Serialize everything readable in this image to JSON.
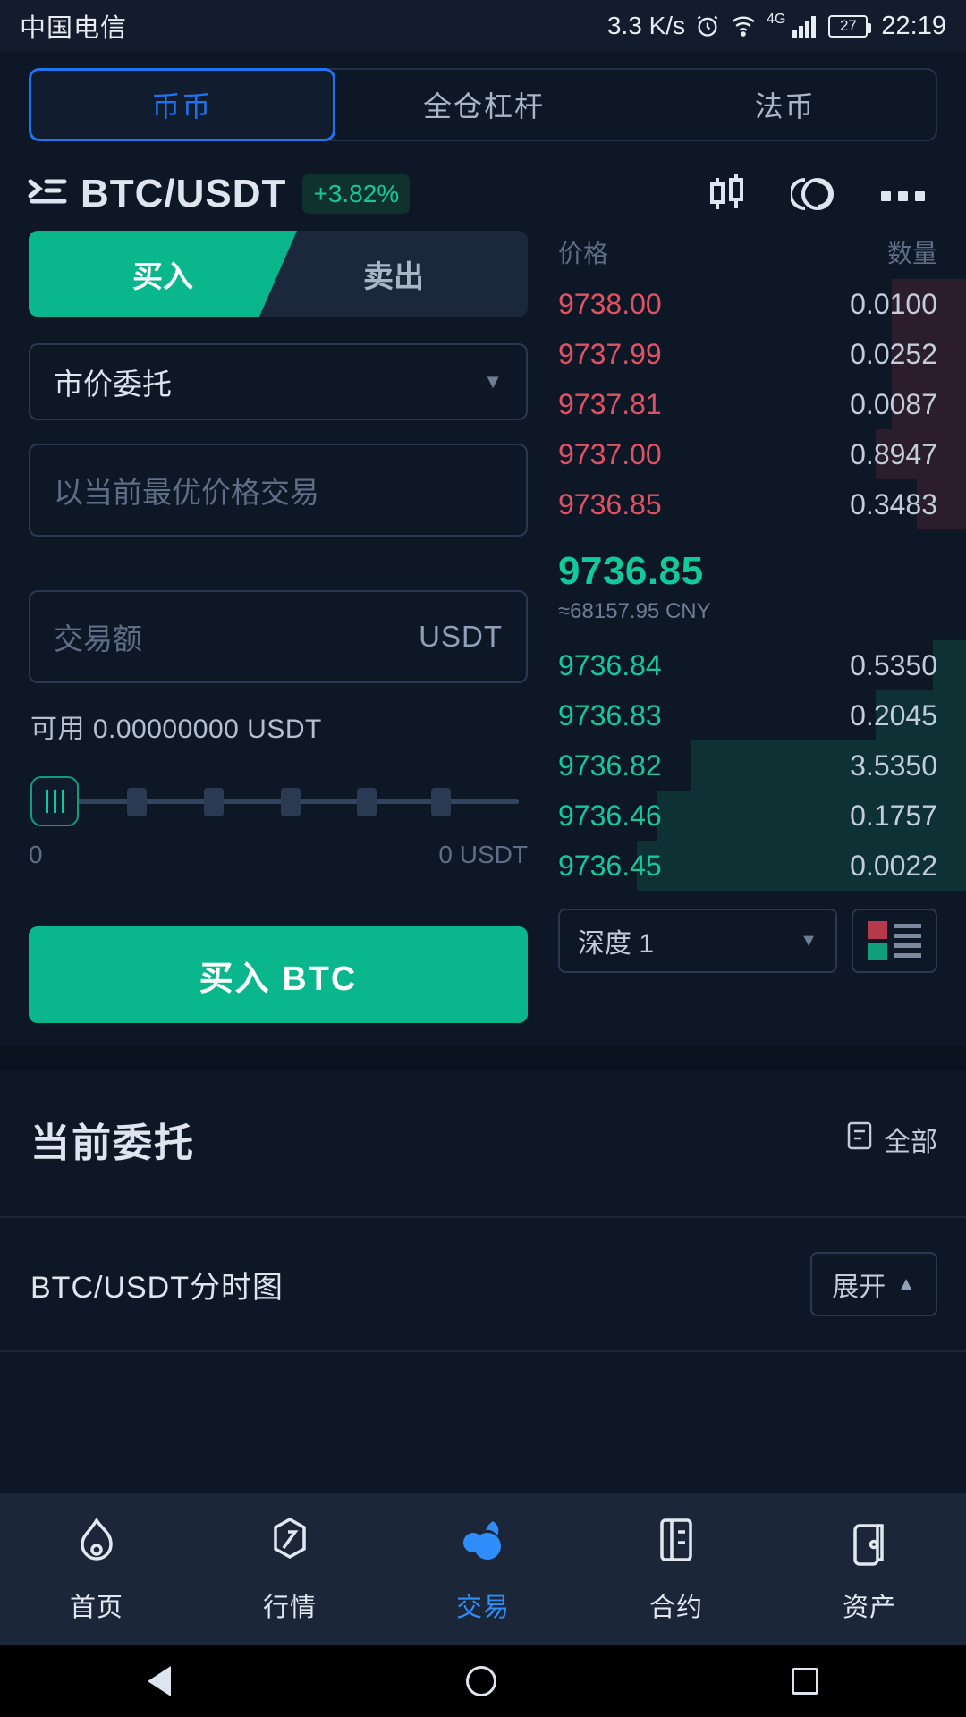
{
  "statusbar": {
    "carrier": "中国电信",
    "speed": "3.3 K/s",
    "network": "4G",
    "battery": "27",
    "time": "22:19"
  },
  "segments": [
    {
      "label": "币币",
      "active": true
    },
    {
      "label": "全仓杠杆",
      "active": false
    },
    {
      "label": "法币",
      "active": false
    }
  ],
  "ticker": {
    "pair": "BTC/USDT",
    "change": "+3.82%",
    "change_color": "#12c99b"
  },
  "trade": {
    "buy_tab": "买入",
    "sell_tab": "卖出",
    "order_type": "市价委托",
    "price_placeholder": "以当前最优价格交易",
    "amount_placeholder": "交易额",
    "amount_unit": "USDT",
    "available": "可用 0.00000000 USDT",
    "slider_min": "0",
    "slider_max": "0 USDT",
    "cta": "买入 BTC"
  },
  "orderbook": {
    "col_price": "价格",
    "col_amount": "数量",
    "asks": [
      {
        "price": "9738.00",
        "amount": "0.0100",
        "depth": 18
      },
      {
        "price": "9737.99",
        "amount": "0.0252",
        "depth": 18
      },
      {
        "price": "9737.81",
        "amount": "0.0087",
        "depth": 18
      },
      {
        "price": "9737.00",
        "amount": "0.8947",
        "depth": 22
      },
      {
        "price": "9736.85",
        "amount": "0.3483",
        "depth": 12
      }
    ],
    "last_price": "9736.85",
    "last_price_cny": "≈68157.95 CNY",
    "bids": [
      {
        "price": "9736.84",
        "amount": "0.5350",
        "depth": 8
      },
      {
        "price": "9736.83",
        "amount": "0.2045",
        "depth": 22
      },
      {
        "price": "9736.82",
        "amount": "3.5350",
        "depth": 67
      },
      {
        "price": "9736.46",
        "amount": "0.1757",
        "depth": 75
      },
      {
        "price": "9736.45",
        "amount": "0.0022",
        "depth": 80
      }
    ],
    "depth_select": "深度 1",
    "ask_color": "#e05263",
    "bid_color": "#12c99b"
  },
  "current_orders": {
    "title": "当前委托",
    "filter": "全部"
  },
  "chart": {
    "title": "BTC/USDT分时图",
    "expand": "展开"
  },
  "nav": [
    {
      "label": "首页",
      "icon": "flame-icon",
      "active": false
    },
    {
      "label": "行情",
      "icon": "market-icon",
      "active": false
    },
    {
      "label": "交易",
      "icon": "trade-icon",
      "active": true
    },
    {
      "label": "合约",
      "icon": "contract-icon",
      "active": false
    },
    {
      "label": "资产",
      "icon": "assets-icon",
      "active": false
    }
  ]
}
